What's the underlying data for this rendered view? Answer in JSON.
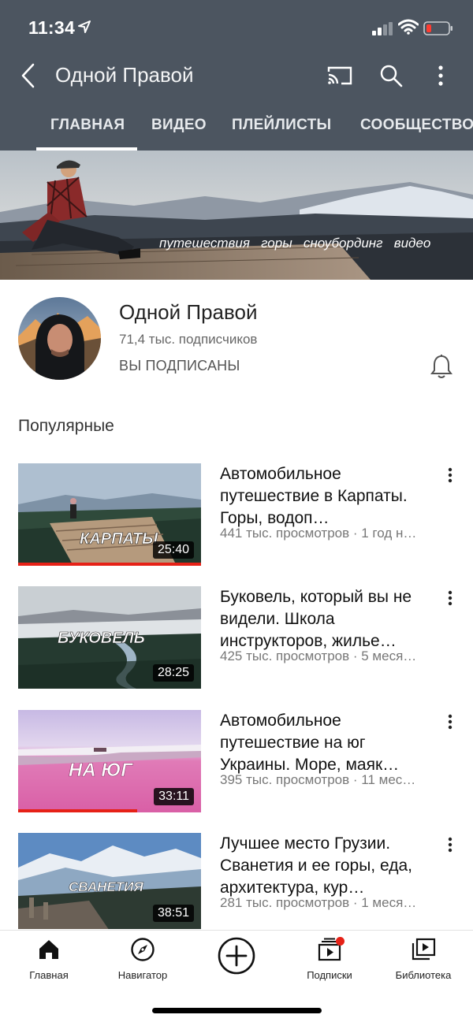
{
  "status_bar": {
    "time": "11:34",
    "icons": [
      "location-arrow-icon",
      "cellular-signal-icon",
      "wifi-icon",
      "battery-low-icon"
    ]
  },
  "app_bar": {
    "channel_title": "Одной Правой",
    "icons": [
      "back-icon",
      "cast-icon",
      "search-icon",
      "more-vertical-icon"
    ]
  },
  "tabs": [
    {
      "label": "ГЛАВНАЯ",
      "active": true
    },
    {
      "label": "ВИДЕО",
      "active": false
    },
    {
      "label": "ПЛЕЙЛИСТЫ",
      "active": false
    },
    {
      "label": "СООБЩЕСТВО",
      "active": false
    }
  ],
  "banner": {
    "tagline": "путешествия   горы   сноубординг   видео"
  },
  "channel": {
    "name": "Одной Правой",
    "subscribers": "71,4 тыс. подписчиков",
    "subscription_status": "ВЫ ПОДПИСАНЫ"
  },
  "section": {
    "title": "Популярные"
  },
  "videos": [
    {
      "thumb_text": "КАРПАТЫ",
      "duration": "25:40",
      "watched": 1.0,
      "title": "Автомобильное путешествие в Карпаты. Горы, водоп…",
      "meta": "441 тыс. просмотров · 1 год н…"
    },
    {
      "thumb_text": "БУКОВЕЛЬ",
      "duration": "28:25",
      "watched": 0,
      "title": "Буковель, который вы не видели. Школа инструкторов, жилье…",
      "meta": "425 тыс. просмотров · 5 меся…"
    },
    {
      "thumb_text": "НА ЮГ",
      "duration": "33:11",
      "watched": 0.65,
      "title": "Автомобильное путешествие на юг Украины.  Море, маяк…",
      "meta": "395 тыс. просмотров · 11 мес…"
    },
    {
      "thumb_text": "СВАНЕТИЯ",
      "duration": "38:51",
      "watched": 0,
      "title": "Лучшее место Грузии. Сванетия и ее горы, еда, архитектура, кур…",
      "meta": "281 тыс. просмотров · 1 меся…"
    }
  ],
  "bottom_nav": [
    {
      "label": "Главная",
      "icon": "home-icon",
      "active": true
    },
    {
      "label": "Навигатор",
      "icon": "compass-icon",
      "active": false
    },
    {
      "label": "",
      "icon": "add-circle-icon",
      "active": false
    },
    {
      "label": "Подписки",
      "icon": "subscriptions-icon",
      "active": false,
      "notification_dot": true
    },
    {
      "label": "Библиотека",
      "icon": "library-icon",
      "active": false
    }
  ],
  "colors": {
    "header_bg": "#4c5560",
    "progress_red": "#e62117",
    "notification_dot": "#e62117"
  }
}
